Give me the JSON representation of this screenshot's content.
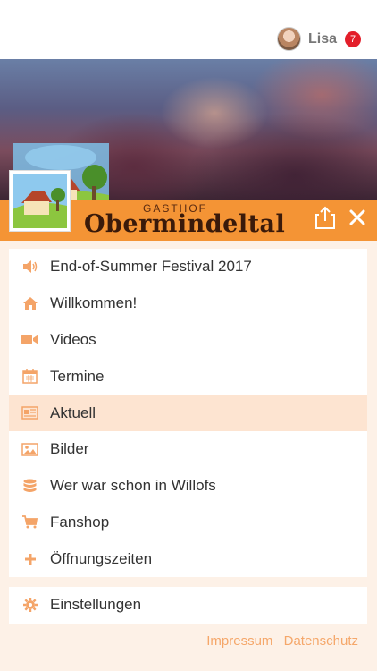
{
  "user": {
    "name": "Lisa",
    "notification_count": "7"
  },
  "brand": {
    "subtitle": "GASTHOF",
    "title": "Obermindeltal"
  },
  "menu": {
    "items": [
      {
        "label": "End-of-Summer Festival 2017",
        "icon": "speaker-icon",
        "active": false
      },
      {
        "label": "Willkommen!",
        "icon": "home-icon",
        "active": false
      },
      {
        "label": "Videos",
        "icon": "video-camera-icon",
        "active": false
      },
      {
        "label": "Termine",
        "icon": "calendar-icon",
        "active": false
      },
      {
        "label": "Aktuell",
        "icon": "newspaper-icon",
        "active": true
      },
      {
        "label": "Bilder",
        "icon": "image-icon",
        "active": false
      },
      {
        "label": "Wer war schon in Willofs",
        "icon": "database-icon",
        "active": false
      },
      {
        "label": "Fanshop",
        "icon": "cart-icon",
        "active": false
      },
      {
        "label": "Öffnungszeiten",
        "icon": "plus-icon",
        "active": false
      }
    ],
    "settings": {
      "label": "Einstellungen",
      "icon": "gear-icon"
    }
  },
  "footer": {
    "impressum": "Impressum",
    "datenschutz": "Datenschutz"
  },
  "colors": {
    "accent": "#f49435",
    "active_row": "#fde4d1",
    "background": "#fdf1e7",
    "badge": "#e31e2a",
    "icon": "#f4a468"
  }
}
